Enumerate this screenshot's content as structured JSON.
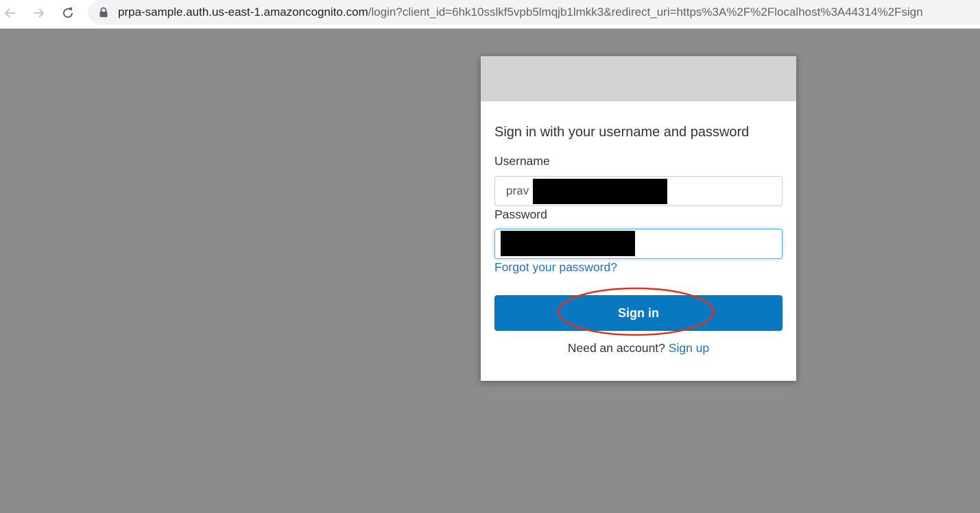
{
  "browser": {
    "url_host": "prpa-sample.auth.us-east-1.amazoncognito.com",
    "url_path": "/login?client_id=6hk10sslkf5vpb5lmqjb1lmkk3&redirect_uri=https%3A%2F%2Flocalhost%3A44314%2Fsign"
  },
  "login": {
    "title": "Sign in with your username and password",
    "username_label": "Username",
    "username_value": "prav",
    "password_label": "Password",
    "forgot_password": "Forgot your password?",
    "signin_button": "Sign in",
    "need_account": "Need an account?",
    "signup_link": "Sign up"
  },
  "icons": {
    "back": "arrow-left-icon",
    "forward": "arrow-right-icon",
    "reload": "reload-icon",
    "lock": "lock-icon"
  },
  "colors": {
    "page_background": "#8c8c8c",
    "banner": "#d3d3d3",
    "primary_button": "#0879c0",
    "link": "#1a73b8",
    "highlight": "#e0321e"
  }
}
